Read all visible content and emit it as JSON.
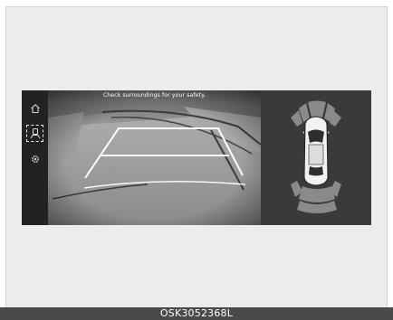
{
  "camera": {
    "message": "Check surroundings for your safety."
  },
  "sidebar": {
    "items": [
      {
        "icon": "home-icon"
      },
      {
        "icon": "rear-view-icon",
        "selected": true
      },
      {
        "icon": "settings-icon"
      }
    ]
  },
  "caption": {
    "code": "OSK3052368L"
  },
  "colors": {
    "guide_lines": "#ffffff",
    "sensor_zone": "#8a8a8a",
    "panel_bg": "#3a3a3a"
  }
}
